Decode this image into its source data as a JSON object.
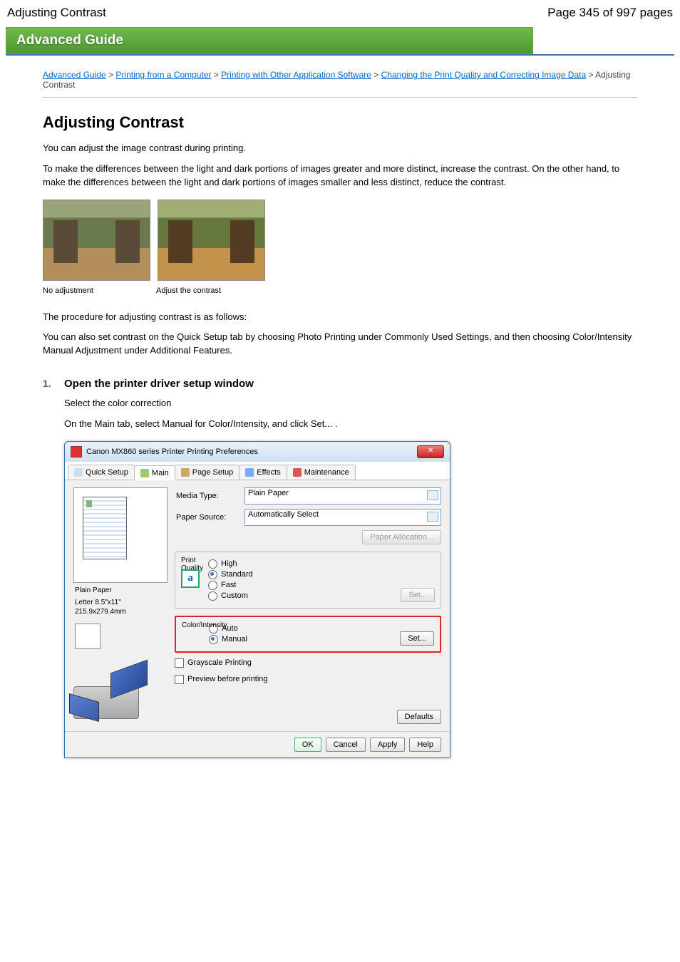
{
  "header": {
    "title": "Adjusting Contrast",
    "page": "Page 345 of 997 pages"
  },
  "banner": "Advanced Guide",
  "breadcrumb": [
    "Advanced Guide",
    "Printing from a Computer",
    "Printing with Other Application Software",
    "Changing the Print Quality and Correcting Image Data",
    "Adjusting Contrast"
  ],
  "h1": "Adjusting Contrast",
  "p1": "You can adjust the image contrast during printing.",
  "p2": "To make the differences between the light and dark portions of images greater and more distinct, increase the contrast. On the other hand, to make the differences between the light and dark portions of images smaller and less distinct, reduce the contrast.",
  "caption": {
    "a": "No adjustment",
    "b": "Adjust the contrast"
  },
  "p3": "The procedure for adjusting contrast is as follows:",
  "p4": "You can also set contrast on the Quick Setup tab by choosing Photo Printing under Commonly Used Settings, and then choosing Color/Intensity Manual Adjustment under Additional Features.",
  "step": {
    "num": "1.",
    "title": "Open the printer driver setup window",
    "body": "Select the color correction",
    "desc": "On the Main tab, select Manual for Color/Intensity, and click Set... ."
  },
  "lowhint": "Select the color correction",
  "dlg": {
    "title": "Canon MX860 series Printer Printing Preferences",
    "tabs": [
      "Quick Setup",
      "Main",
      "Page Setup",
      "Effects",
      "Maintenance"
    ],
    "media": {
      "label": "Media Type:",
      "value": "Plain Paper"
    },
    "source": {
      "label": "Paper Source:",
      "value": "Automatically Select"
    },
    "paperalloc": "Paper Allocation...",
    "quality": {
      "label": "Print Quality",
      "opts": [
        "High",
        "Standard",
        "Fast",
        "Custom"
      ],
      "selected": "Standard",
      "set": "Set..."
    },
    "color": {
      "label": "Color/Intensity",
      "opts": [
        "Auto",
        "Manual"
      ],
      "selected": "Manual",
      "set": "Set..."
    },
    "gray": "Grayscale Printing",
    "previewchk": "Preview before printing",
    "preview": {
      "name": "Plain Paper",
      "size": "Letter 8.5\"x11\" 215.9x279.4mm"
    },
    "defaults": "Defaults",
    "ok": "OK",
    "cancel": "Cancel",
    "apply": "Apply",
    "help": "Help"
  }
}
